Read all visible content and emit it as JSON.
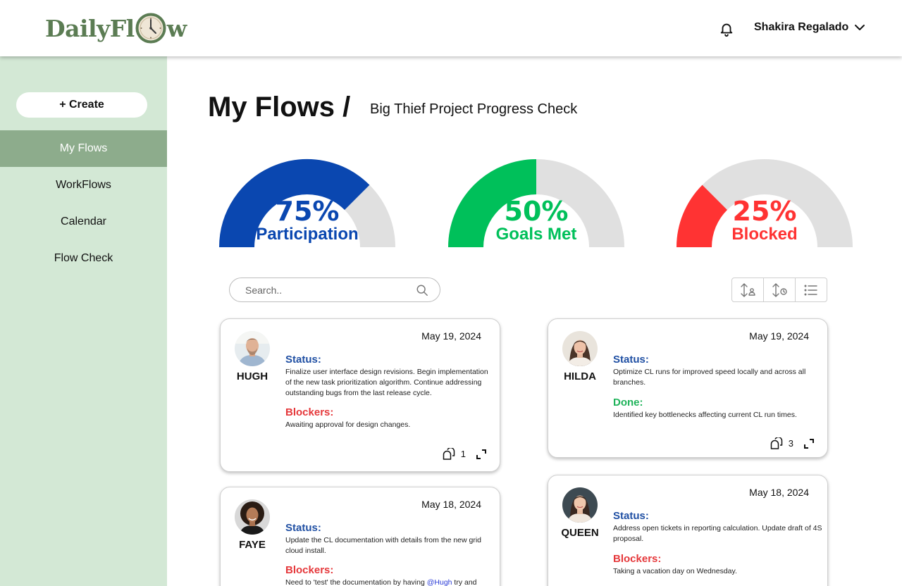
{
  "header": {
    "logo_text_before": "DailyFl",
    "logo_text_after": "w",
    "user_name": "Shakira Regalado"
  },
  "sidebar": {
    "create_label": "+ Create",
    "items": [
      {
        "label": "My Flows",
        "active": true
      },
      {
        "label": "WorkFlows",
        "active": false
      },
      {
        "label": "Calendar",
        "active": false
      },
      {
        "label": "Flow Check",
        "active": false
      }
    ]
  },
  "page": {
    "title": "My Flows /",
    "subtitle": "Big Thief Project Progress Check"
  },
  "gauges": [
    {
      "value_text": "75%",
      "label": "Participation",
      "fraction": 0.75,
      "color": "#0a47b0"
    },
    {
      "value_text": "50%",
      "label": "Goals Met",
      "fraction": 0.5,
      "color": "#00c05a"
    },
    {
      "value_text": "25%",
      "label": "Blocked",
      "fraction": 0.25,
      "color": "#ff3333"
    }
  ],
  "search": {
    "placeholder": "Search.."
  },
  "colors": {
    "sidebar_bg": "#d3e8d5",
    "sidebar_active": "#8dac8c",
    "logo": "#5b7c53",
    "track": "#e0e0e0"
  },
  "cards": [
    {
      "name": "HUGH",
      "date": "May 19, 2024",
      "status_label": "Status:",
      "status_text": "Finalize user interface design revisions. Begin implementation of the new task prioritization algorithm. Continue addressing outstanding bugs from the last release cycle.",
      "second_label": "Blockers:",
      "second_text": "Awaiting approval for design changes.",
      "comments": "1"
    },
    {
      "name": "HILDA",
      "date": "May 19, 2024",
      "status_label": "Status:",
      "status_text": "Optimize CL runs for improved speed locally and across all branches.",
      "second_label": "Done:",
      "second_text": "Identified key bottlenecks affecting current CL run times.",
      "comments": "3"
    },
    {
      "name": "FAYE",
      "date": "May 18, 2024",
      "status_label": "Status:",
      "status_text": "Update the CL documentation with details from the new grid cloud install.",
      "second_label": "Blockers:",
      "second_text_before": "Need to 'test' the documentation by having ",
      "mention": "@Hugh",
      "second_text_after": " try and"
    },
    {
      "name": "QUEEN",
      "date": "May 18, 2024",
      "status_label": "Status:",
      "status_text": "Address open tickets in reporting calculation. Update draft of 4S proposal.",
      "second_label": "Blockers:",
      "second_text": "Taking a vacation day on Wednesday."
    }
  ]
}
